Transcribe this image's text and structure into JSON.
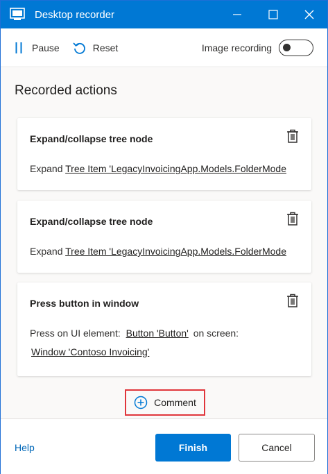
{
  "window": {
    "title": "Desktop recorder",
    "accent": "#0078d4"
  },
  "toolbar": {
    "pause_label": "Pause",
    "reset_label": "Reset",
    "image_recording_label": "Image recording",
    "image_recording_on": false
  },
  "main": {
    "section_title": "Recorded actions",
    "actions": [
      {
        "title": "Expand/collapse tree node",
        "prefix": "Expand",
        "link": "Tree Item 'LegacyInvoicingApp.Models.FolderMode"
      },
      {
        "title": "Expand/collapse tree node",
        "prefix": "Expand",
        "link": "Tree Item 'LegacyInvoicingApp.Models.FolderMode"
      },
      {
        "title": "Press button in window",
        "prefix": "Press on UI element:",
        "link": "Button 'Button'",
        "middle": "on screen:",
        "link2": "Window 'Contoso Invoicing'"
      }
    ],
    "comment_label": "Comment"
  },
  "footer": {
    "help_label": "Help",
    "finish_label": "Finish",
    "cancel_label": "Cancel"
  }
}
